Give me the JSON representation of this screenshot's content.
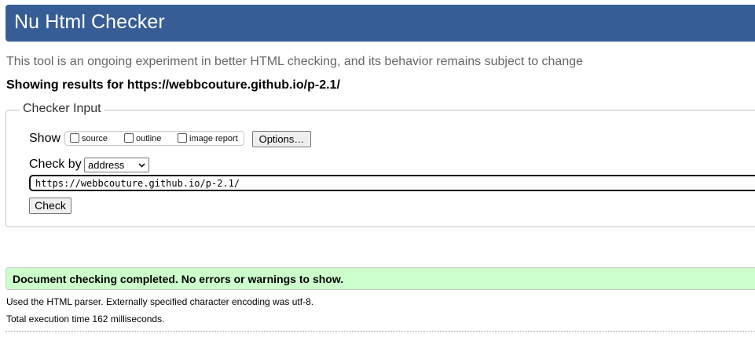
{
  "header": {
    "title": "Nu Html Checker"
  },
  "intro": "This tool is an ongoing experiment in better HTML checking, and its behavior remains subject to change",
  "showing": "Showing results for https://webbcouture.github.io/p-2.1/",
  "checker_input": {
    "legend": "Checker Input",
    "show_label": "Show",
    "options": [
      {
        "label": "source",
        "checked": false
      },
      {
        "label": "outline",
        "checked": false
      },
      {
        "label": "image report",
        "checked": false
      }
    ],
    "options_button": "Options…",
    "check_by_label": "Check by",
    "check_by_value": "address",
    "url_value": "https://webbcouture.github.io/p-2.1/",
    "check_button": "Check"
  },
  "result": {
    "message": "Document checking completed. No errors or warnings to show.",
    "color": "#ccffcc"
  },
  "details": {
    "parser": "Used the HTML parser. Externally specified character encoding was utf-8.",
    "time": "Total execution time 162 milliseconds."
  },
  "colors": {
    "header_bg": "#365d95",
    "header_text": "#ffffff"
  }
}
